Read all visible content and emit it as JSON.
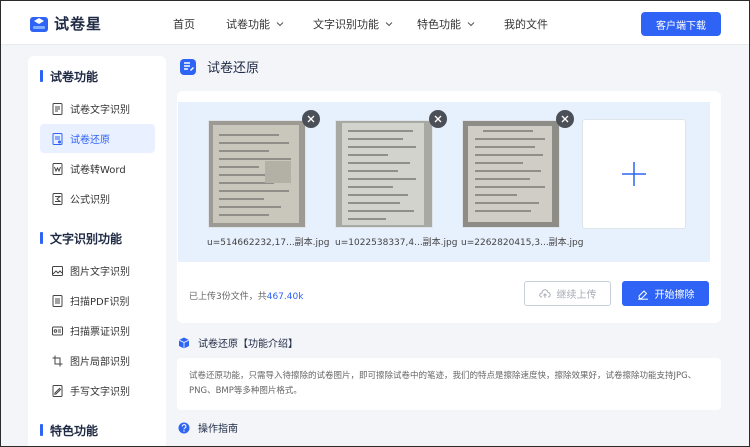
{
  "header": {
    "brand": "试卷星",
    "nav": [
      {
        "label": "首页"
      },
      {
        "label": "试卷功能"
      },
      {
        "label": "文字识别功能"
      },
      {
        "label": "特色功能"
      },
      {
        "label": "我的文件"
      }
    ],
    "download_label": "客户端下载"
  },
  "sidebar": {
    "groups": [
      {
        "title": "试卷功能",
        "items": [
          {
            "label": "试卷文字识别",
            "icon": "doc-scan-icon"
          },
          {
            "label": "试卷还原",
            "icon": "doc-restore-icon",
            "active": true
          },
          {
            "label": "试卷转Word",
            "icon": "doc-word-icon"
          },
          {
            "label": "公式识别",
            "icon": "formula-icon"
          }
        ]
      },
      {
        "title": "文字识别功能",
        "items": [
          {
            "label": "图片文字识别",
            "icon": "image-icon"
          },
          {
            "label": "扫描PDF识别",
            "icon": "pdf-scan-icon"
          },
          {
            "label": "扫描票证识别",
            "icon": "ticket-icon"
          },
          {
            "label": "图片局部识别",
            "icon": "crop-icon"
          },
          {
            "label": "手写文字识别",
            "icon": "handwrite-icon"
          }
        ]
      },
      {
        "title": "特色功能",
        "items": []
      }
    ]
  },
  "main": {
    "title": "试卷还原",
    "files": [
      {
        "name": "u=514662232,17...副本.jpg"
      },
      {
        "name": "u=1022538337,4...副本.jpg"
      },
      {
        "name": "u=2262820415,3...副本.jpg"
      }
    ],
    "status_prefix": "已上传3份文件，共",
    "status_size": "467.40k",
    "continue_label": "继续上传",
    "start_label": "开始擦除",
    "intro_title": "试卷还原【功能介绍】",
    "intro_text": "试卷还原功能，只需导入待擦除的试卷图片，即可擦除试卷中的笔迹，我们的特点是擦除速度快，擦除效果好，试卷擦除功能支持JPG、PNG、BMP等多种图片格式。",
    "guide_title": "操作指南"
  },
  "colors": {
    "accent": "#2f63f6",
    "upload_bg": "#e7f0fd",
    "page_bg": "#f3f5f9"
  }
}
